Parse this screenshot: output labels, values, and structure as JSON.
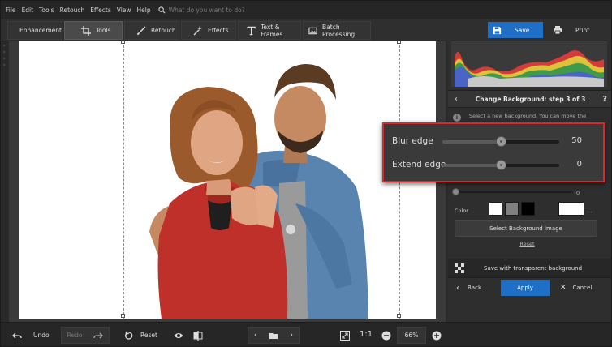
{
  "menu": {
    "items": [
      "File",
      "Edit",
      "Tools",
      "Retouch",
      "Effects",
      "View",
      "Help"
    ],
    "search_placeholder": "What do you want to do?"
  },
  "toolbar": {
    "tabs": [
      {
        "label": "Enhancement",
        "icon": "sliders-icon"
      },
      {
        "label": "Tools",
        "icon": "crop-icon",
        "active": true
      },
      {
        "label": "Retouch",
        "icon": "brush-icon"
      },
      {
        "label": "Effects",
        "icon": "sparkle-icon"
      },
      {
        "label": "Text & Frames",
        "icon": "text-icon"
      },
      {
        "label": "Batch Processing",
        "icon": "images-icon"
      }
    ],
    "save_label": "Save",
    "print_label": "Print"
  },
  "panel": {
    "title": "Change Background: step 3 of 3",
    "info_line1": "Select a new background. You can move the",
    "background_slider_value": "0",
    "color_label": "Color",
    "swatches": [
      "#ffffff",
      "#808080",
      "#000000"
    ],
    "custom_swatch": "#ffffff",
    "more_label": "...",
    "select_image_label": "Select Background Image",
    "reset_label": "Reset",
    "transparent_label": "Save with transparent background",
    "back_label": "Back",
    "apply_label": "Apply",
    "cancel_label": "Cancel"
  },
  "callout": {
    "blur_label": "Blur edge",
    "blur_value": "50",
    "extend_label": "Extend edge",
    "extend_value": "0"
  },
  "bottombar": {
    "undo_label": "Undo",
    "redo_label": "Redo",
    "reset_label": "Reset",
    "ratio_label": "1:1",
    "zoom": "66%"
  },
  "colors": {
    "accent": "#1f6fc6",
    "callout_border": "#d8272f"
  }
}
